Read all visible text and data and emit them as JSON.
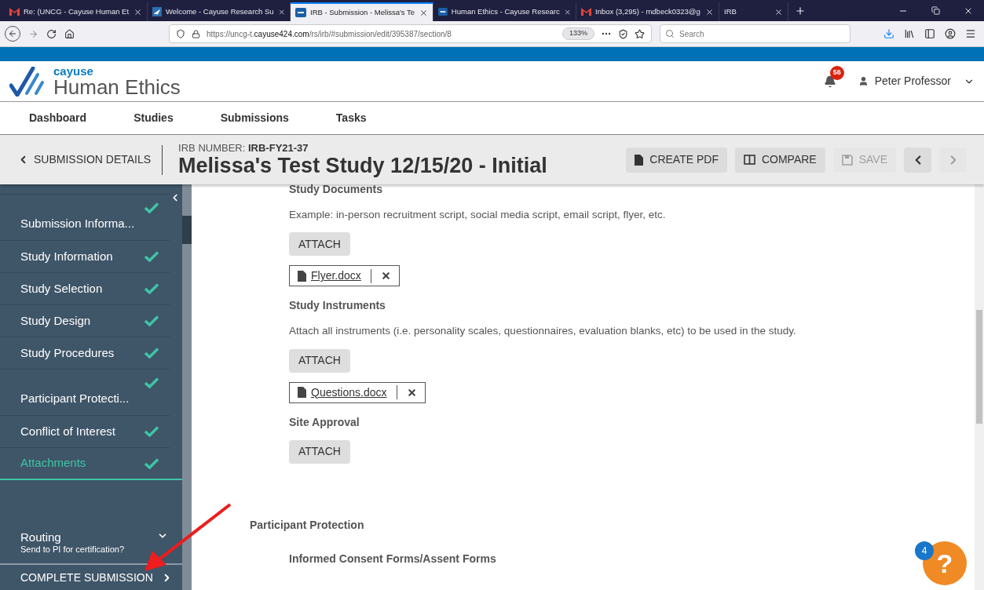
{
  "browser": {
    "tabs": [
      {
        "label": "Re: (UNCG - Cayuse Human Et",
        "kind": "mail",
        "selected": false
      },
      {
        "label": "Welcome - Cayuse Research Su",
        "kind": "bird",
        "selected": false
      },
      {
        "label": "IRB - Submission - Melissa's Te",
        "kind": "app",
        "selected": true
      },
      {
        "label": "Human Ethics - Cayuse Researc",
        "kind": "app",
        "selected": false
      },
      {
        "label": "Inbox (3,295) - mdbeck0323@g",
        "kind": "mail",
        "selected": false
      },
      {
        "label": "IRB",
        "kind": "none",
        "selected": false
      }
    ],
    "url": {
      "prefix": "https://uncg-t.",
      "domain": "cayuse424.com",
      "path": "/rs/irb/#submission/edit/395387/section/8"
    },
    "zoom": "133%",
    "search_placeholder": "Search"
  },
  "header": {
    "logo_top": "cayuse",
    "logo_bottom": "Human Ethics",
    "notifications": "56",
    "user": "Peter Professor"
  },
  "nav": [
    "Dashboard",
    "Studies",
    "Submissions",
    "Tasks"
  ],
  "details_bar": {
    "back": "SUBMISSION DETAILS",
    "irb_label": "IRB NUMBER:",
    "irb_number": "IRB-FY21-37",
    "title": "Melissa's Test Study 12/15/20 - Initial",
    "buttons": [
      {
        "label": "CREATE PDF",
        "kind": "pdf",
        "disabled": false
      },
      {
        "label": "COMPARE",
        "kind": "compare",
        "disabled": false
      },
      {
        "label": "SAVE",
        "kind": "save",
        "disabled": true
      }
    ],
    "prev_disabled": false,
    "next_disabled": true
  },
  "sidebar": {
    "items": [
      {
        "label": "Submission Informa...",
        "checked": true,
        "selected": false,
        "tall": true
      },
      {
        "label": "Study Information",
        "checked": true,
        "selected": false,
        "tall": false
      },
      {
        "label": "Study Selection",
        "checked": true,
        "selected": false,
        "tall": false
      },
      {
        "label": "Study Design",
        "checked": true,
        "selected": false,
        "tall": false
      },
      {
        "label": "Study Procedures",
        "checked": true,
        "selected": false,
        "tall": false
      },
      {
        "label": "Participant Protecti...",
        "checked": true,
        "selected": false,
        "tall": true
      },
      {
        "label": "Conflict of Interest",
        "checked": true,
        "selected": false,
        "tall": false
      },
      {
        "label": "Attachments",
        "checked": true,
        "selected": true,
        "tall": false
      }
    ],
    "routing": {
      "title": "Routing",
      "subtitle": "Send to PI for certification?"
    },
    "complete": "COMPLETE SUBMISSION"
  },
  "content": {
    "sections": [
      {
        "title": "Study Documents",
        "description": "Example: in-person recruitment script, social media script, email script, flyer, etc.",
        "button": "ATTACH",
        "files": [
          "Flyer.docx"
        ]
      },
      {
        "title": "Study Instruments",
        "description": "Attach all instruments (i.e. personality scales, questionnaires, evaluation blanks, etc) to be used in the study.",
        "button": "ATTACH",
        "files": [
          "Questions.docx"
        ]
      },
      {
        "title": "Site Approval",
        "button": "ATTACH"
      }
    ],
    "group_title": "Participant Protection",
    "next_section": "Informed Consent Forms/Assent Forms"
  },
  "help": {
    "badge": "4",
    "label": "?"
  }
}
